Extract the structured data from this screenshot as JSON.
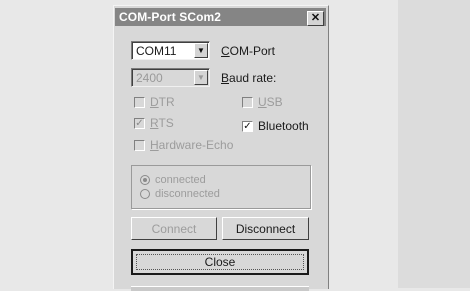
{
  "window": {
    "title": "COM-Port SCom2",
    "close_glyph": "✕"
  },
  "port": {
    "value": "COM11",
    "label": "COM-Port",
    "label_underline": "C",
    "label_rest": "OM-Port"
  },
  "baud": {
    "value": "2400",
    "label_underline": "B",
    "label_rest": "aud rate:"
  },
  "checkboxes": {
    "dtr": {
      "label_underline": "D",
      "label_rest": "TR",
      "checked": false
    },
    "usb": {
      "label_underline": "U",
      "label_rest": "SB",
      "checked": false
    },
    "rts": {
      "label_underline": "R",
      "label_rest": "TS",
      "checked": true
    },
    "bluetooth": {
      "label": "Bluetooth",
      "checked": true
    },
    "hardware_echo": {
      "label_underline": "H",
      "label_rest": "ardware-Echo",
      "checked": false
    }
  },
  "status": {
    "connected": {
      "label": "connected",
      "selected": true
    },
    "disconnected": {
      "label": "disconnected",
      "selected": false
    }
  },
  "buttons": {
    "connect": "Connect",
    "disconnect": "Disconnect",
    "close": "Close"
  },
  "glyphs": {
    "check": "✓",
    "down_arrow": "▼"
  }
}
